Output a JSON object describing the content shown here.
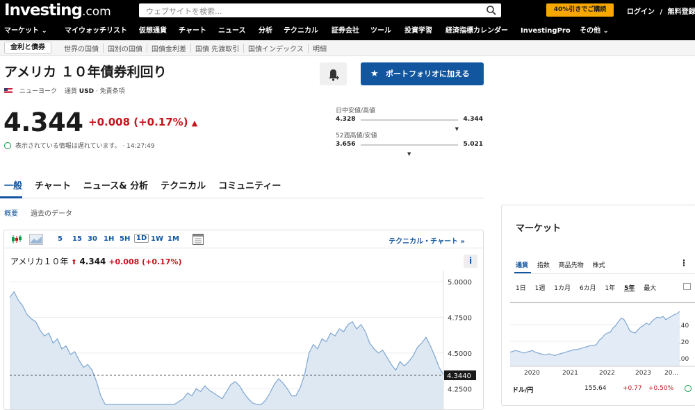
{
  "header": {
    "logo_main": "Investing",
    "logo_suffix": ".com",
    "search_placeholder": "ウェブサイトを検索...",
    "promo": "40%引きでご購読",
    "login": "ログイン",
    "divider": "/",
    "signup": "無料登録"
  },
  "nav": [
    {
      "label": "マーケット ⌄"
    },
    {
      "label": "マイウォッチリスト"
    },
    {
      "label": "仮想通貨"
    },
    {
      "label": "チャート"
    },
    {
      "label": "ニュース"
    },
    {
      "label": "分析"
    },
    {
      "label": "テクニカル"
    },
    {
      "label": "証券会社"
    },
    {
      "label": "ツール"
    },
    {
      "label": "投資学習"
    },
    {
      "label": "経済指標カレンダー"
    },
    {
      "label": "InvestingPro"
    },
    {
      "label": "その他 ⌄"
    }
  ],
  "subnav": [
    {
      "label": "金利と債券"
    },
    {
      "label": "世界の国債"
    },
    {
      "label": "国別の国債"
    },
    {
      "label": "国債金利差"
    },
    {
      "label": "国債 先渡取引"
    },
    {
      "label": "国債インデックス"
    },
    {
      "label": "明細"
    }
  ],
  "instrument": {
    "title": "アメリカ １０年債券利回り",
    "exchange": "ニューヨーク",
    "currency_label": "通貨",
    "currency": "USD",
    "terms": "免責条項",
    "price": "4.344",
    "change": "+0.008 (+0.17%)",
    "delay_note": "表示されている情報は遅れています。",
    "time": "· 14:27:49",
    "portfolio_button": "ポートフォリオに加える"
  },
  "ranges": {
    "day": {
      "label": "日中安値/高値",
      "low": "4.328",
      "high": "4.344",
      "position": 0.99
    },
    "week52": {
      "label": "52週高値/安値",
      "low": "3.656",
      "high": "5.021",
      "position": 0.5
    }
  },
  "tabs": [
    {
      "label": "一般"
    },
    {
      "label": "チャート"
    },
    {
      "label": "ニュース& 分析"
    },
    {
      "label": "テクニカル"
    },
    {
      "label": "コミュニティー"
    }
  ],
  "subtabs": [
    {
      "label": "概要"
    },
    {
      "label": "過去のデータ"
    }
  ],
  "chart_toolbar": {
    "timeframes": [
      "5",
      "15",
      "30",
      "1H",
      "5H",
      "1D",
      "1W",
      "1M"
    ],
    "selected": "1D",
    "tech_link": "テクニカル・チャート »"
  },
  "chart_data": [
    {
      "type": "area",
      "title": "アメリカ１０年",
      "header_value": "4.344",
      "header_change": "+0.008",
      "header_pct": "(+0.17%)",
      "last_price_label": "4.3440",
      "y_ticks": [
        "5.0000",
        "4.7500",
        "4.5000",
        "4.2500"
      ],
      "ylim": [
        4.13,
        5.02
      ],
      "last_value": 4.344,
      "values": [
        4.89,
        4.93,
        4.87,
        4.83,
        4.77,
        4.74,
        4.72,
        4.66,
        4.62,
        4.64,
        4.57,
        4.6,
        4.53,
        4.55,
        4.49,
        4.51,
        4.45,
        4.4,
        4.42,
        4.38,
        4.3,
        4.2,
        4.14,
        4.14,
        4.14,
        4.14,
        4.14,
        4.14,
        4.14,
        4.14,
        4.14,
        4.14,
        4.14,
        4.14,
        4.14,
        4.14,
        4.14,
        4.14,
        4.14,
        4.16,
        4.18,
        4.22,
        4.2,
        4.25,
        4.23,
        4.27,
        4.24,
        4.22,
        4.2,
        4.18,
        4.23,
        4.28,
        4.3,
        4.27,
        4.22,
        4.18,
        4.15,
        4.14,
        4.14,
        4.17,
        4.22,
        4.28,
        4.32,
        4.29,
        4.25,
        4.2,
        4.2,
        4.26,
        4.35,
        4.5,
        4.56,
        4.53,
        4.6,
        4.58,
        4.64,
        4.62,
        4.67,
        4.65,
        4.7,
        4.72,
        4.67,
        4.7,
        4.65,
        4.57,
        4.53,
        4.5,
        4.52,
        4.47,
        4.42,
        4.38,
        4.44,
        4.41,
        4.44,
        4.48,
        4.54,
        4.57,
        4.61,
        4.55,
        4.48,
        4.4,
        4.35
      ]
    },
    {
      "type": "area",
      "title": "ドル/円",
      "x_ticks": [
        "2020",
        "2021",
        "2022",
        "2023",
        "20..."
      ],
      "y_ticks": [
        "140",
        "120",
        "100"
      ],
      "ylim": [
        90,
        160
      ],
      "values": [
        107,
        108,
        109,
        108,
        107,
        106,
        107,
        108,
        109,
        107,
        106,
        105,
        104,
        104,
        105,
        104,
        103,
        104,
        105,
        106,
        107,
        108,
        109,
        110,
        110,
        111,
        112,
        113,
        114,
        115,
        115,
        116,
        121,
        124,
        128,
        130,
        131,
        136,
        139,
        144,
        148,
        146,
        140,
        133,
        131,
        130,
        134,
        137,
        139,
        142,
        140,
        144,
        147,
        149,
        148,
        150,
        146,
        148,
        150,
        152,
        153,
        156
      ]
    }
  ],
  "market_panel": {
    "title": "マーケット",
    "tabs": [
      "通貨",
      "指数",
      "商品先物",
      "株式"
    ],
    "periods": [
      "1日",
      "1週",
      "1カ月",
      "6カ月",
      "1年",
      "5年",
      "最大"
    ],
    "selected_period": "5年",
    "row": {
      "name": "ドル/円",
      "price": "155.64",
      "change": "+0.77",
      "pct": "+0.50%"
    }
  },
  "colors": {
    "accent": "#1256a0",
    "down": "#c5161d",
    "promo": "#f7a700"
  }
}
